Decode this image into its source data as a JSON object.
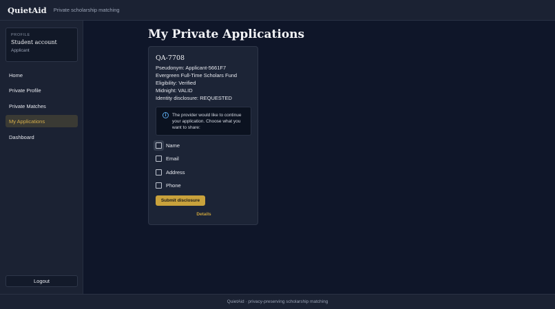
{
  "header": {
    "brand": "QuietAid",
    "tagline": "Private scholarship matching"
  },
  "sidebar": {
    "profile": {
      "kicker": "PROFILE",
      "name": "Student account",
      "role": "Applicant"
    },
    "items": [
      {
        "label": "Home",
        "active": false
      },
      {
        "label": "Private Profile",
        "active": false
      },
      {
        "label": "Private Matches",
        "active": false
      },
      {
        "label": "My Applications",
        "active": true
      },
      {
        "label": "Dashboard",
        "active": false
      }
    ],
    "logout_label": "Logout"
  },
  "main": {
    "title": "My Private Applications",
    "application": {
      "id": "QA-7708",
      "pseudonym": "Pseudonym: Applicant-5661F7",
      "fund": "Evergreen Full-Time Scholars Fund",
      "eligibility": "Eligibility: Verified",
      "midnight": "Midnight: VALID",
      "identity_disclosure": "Identity disclosure: REQUESTED",
      "notice": "The provider would like to continue your application. Choose what you want to share:",
      "options": [
        {
          "label": "Name",
          "checked": false
        },
        {
          "label": "Email",
          "checked": false
        },
        {
          "label": "Address",
          "checked": false
        },
        {
          "label": "Phone",
          "checked": false
        }
      ],
      "submit_label": "Submit disclosure",
      "details_label": "Details"
    }
  },
  "footer": {
    "text": "QuietAid · privacy-preserving scholarship matching"
  },
  "colors": {
    "accent": "#c9a23c",
    "background": "#0f1629",
    "panel": "#1b2233",
    "info": "#5aa6e8"
  }
}
